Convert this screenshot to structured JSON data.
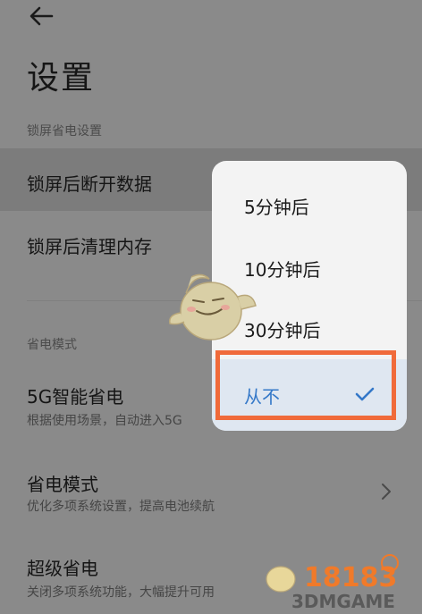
{
  "header": {
    "title": "设置",
    "back_icon": "back-arrow-icon"
  },
  "sections": {
    "lock_screen": {
      "label": "锁屏省电设置",
      "items": [
        {
          "title": "锁屏后断开数据"
        },
        {
          "title": "锁屏后清理内存"
        }
      ]
    },
    "power_mode": {
      "label": "省电模式",
      "items": [
        {
          "title": "5G智能省电",
          "subtitle": "根据使用场景，自动进入5G"
        },
        {
          "title": "省电模式",
          "subtitle": "优化多项系统设置，提高电池续航"
        },
        {
          "title": "超级省电",
          "subtitle": "关闭多项系统功能，大幅提升可用"
        }
      ]
    }
  },
  "popup": {
    "options": [
      "5分钟后",
      "10分钟后",
      "30分钟后",
      "从不"
    ],
    "selected": "从不",
    "check_icon": "checkmark-icon"
  },
  "colors": {
    "accent": "#3478c8",
    "highlight_border": "#f06a3a"
  },
  "watermark": {
    "text_logo": "18183",
    "text_site": "3DMGAME"
  }
}
